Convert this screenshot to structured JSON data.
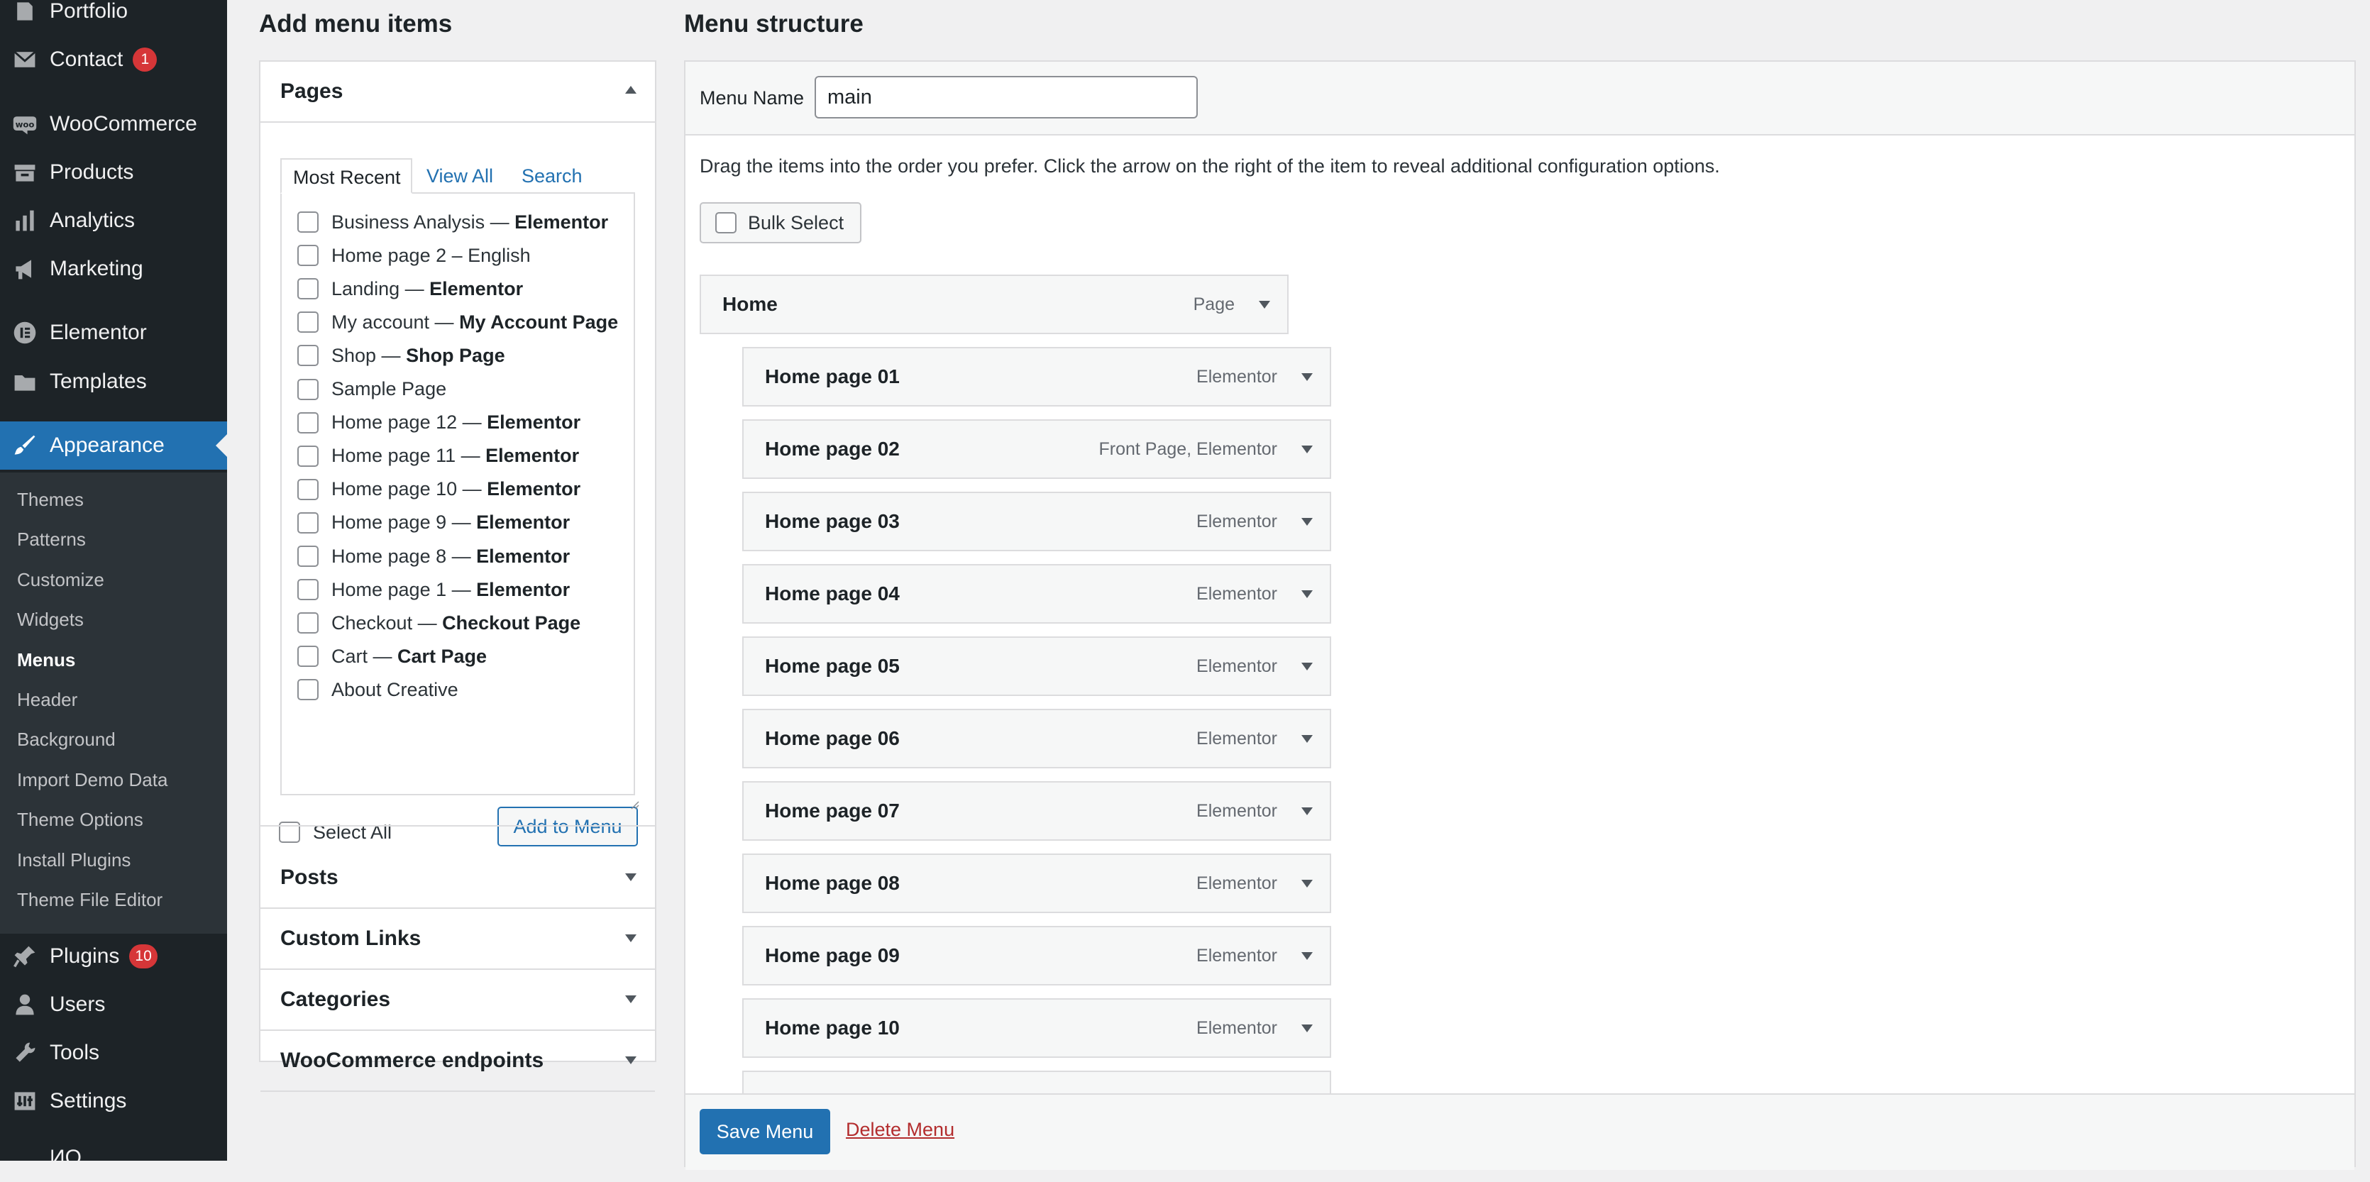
{
  "sidebar": {
    "items_top": [
      {
        "label": "Portfolio",
        "icon": "portfolio-icon"
      },
      {
        "label": "Contact",
        "icon": "mail-icon",
        "badge": "1"
      },
      {
        "label": "WooCommerce",
        "icon": "woocommerce-icon"
      },
      {
        "label": "Products",
        "icon": "archive-icon"
      },
      {
        "label": "Analytics",
        "icon": "bar-chart-icon"
      },
      {
        "label": "Marketing",
        "icon": "megaphone-icon"
      },
      {
        "label": "Elementor",
        "icon": "elementor-icon"
      },
      {
        "label": "Templates",
        "icon": "folder-icon"
      },
      {
        "label": "Appearance",
        "icon": "brush-icon"
      }
    ],
    "submenu": [
      "Themes",
      "Patterns",
      "Customize",
      "Widgets",
      "Menus",
      "Header",
      "Background",
      "Import Demo Data",
      "Theme Options",
      "Install Plugins",
      "Theme File Editor"
    ],
    "items_bottom": [
      {
        "label": "Plugins",
        "icon": "plugin-icon",
        "badge": "10"
      },
      {
        "label": "Users",
        "icon": "users-icon"
      },
      {
        "label": "Tools",
        "icon": "wrench-icon"
      },
      {
        "label": "Settings",
        "icon": "settings-icon"
      },
      {
        "label": "ИО"
      }
    ],
    "active_color": "#2271b1",
    "badge_color": "#d63638"
  },
  "left": {
    "heading": "Add menu items",
    "pages": {
      "title": "Pages",
      "tabs": [
        "Most Recent",
        "View All",
        "Search"
      ],
      "items": [
        {
          "name": "Business Analysis",
          "suffix": "Elementor"
        },
        {
          "name": "Home page 2 – English",
          "suffix": ""
        },
        {
          "name": "Landing",
          "suffix": "Elementor"
        },
        {
          "name": "My account",
          "suffix": "My Account Page"
        },
        {
          "name": "Shop",
          "suffix": "Shop Page"
        },
        {
          "name": "Sample Page",
          "suffix": ""
        },
        {
          "name": "Home page 12",
          "suffix": "Elementor"
        },
        {
          "name": "Home page 11",
          "suffix": "Elementor"
        },
        {
          "name": "Home page 10",
          "suffix": "Elementor"
        },
        {
          "name": "Home page 9",
          "suffix": "Elementor"
        },
        {
          "name": "Home page 8",
          "suffix": "Elementor"
        },
        {
          "name": "Home page 1",
          "suffix": "Elementor"
        },
        {
          "name": "Checkout",
          "suffix": "Checkout Page"
        },
        {
          "name": "Cart",
          "suffix": "Cart Page"
        },
        {
          "name": "About Creative",
          "suffix": ""
        }
      ],
      "dash": " — ",
      "select_all": "Select All",
      "add_button": "Add to Menu"
    },
    "sections": [
      "Posts",
      "Custom Links",
      "Categories",
      "WooCommerce endpoints"
    ]
  },
  "right": {
    "heading": "Menu structure",
    "menu_name_label": "Menu Name",
    "menu_name_value": "main",
    "instructions": "Drag the items into the order you prefer. Click the arrow on the right of the item to reveal additional configuration options.",
    "bulk_select": "Bulk Select",
    "items": [
      {
        "title": "Home",
        "type": "Page",
        "depth": 0
      },
      {
        "title": "Home page 01",
        "type": "Elementor",
        "depth": 1
      },
      {
        "title": "Home page 02",
        "type": "Front Page, Elementor",
        "depth": 1
      },
      {
        "title": "Home page 03",
        "type": "Elementor",
        "depth": 1
      },
      {
        "title": "Home page 04",
        "type": "Elementor",
        "depth": 1
      },
      {
        "title": "Home page 05",
        "type": "Elementor",
        "depth": 1
      },
      {
        "title": "Home page 06",
        "type": "Elementor",
        "depth": 1
      },
      {
        "title": "Home page 07",
        "type": "Elementor",
        "depth": 1
      },
      {
        "title": "Home page 08",
        "type": "Elementor",
        "depth": 1
      },
      {
        "title": "Home page 09",
        "type": "Elementor",
        "depth": 1
      },
      {
        "title": "Home page 10",
        "type": "Elementor",
        "depth": 1
      },
      {
        "title": "",
        "type": "",
        "depth": 1
      }
    ],
    "save_button": "Save Menu",
    "delete_link": "Delete Menu"
  }
}
